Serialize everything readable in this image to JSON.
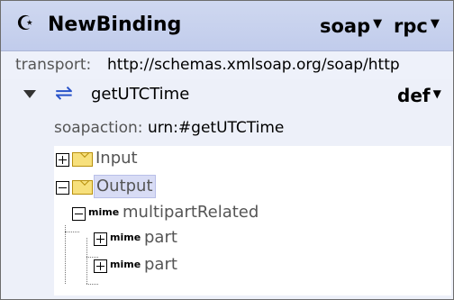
{
  "binding": {
    "icon": "binding-icon",
    "name": "NewBinding",
    "style": "soap",
    "protocol": "rpc",
    "transport_label": "transport:",
    "transport_value": "http://schemas.xmlsoap.org/soap/http"
  },
  "operation": {
    "name": "getUTCTime",
    "use": "def",
    "soapaction_label": "soapaction:",
    "soapaction_value": "urn:#getUTCTime"
  },
  "tree": {
    "input_label": "Input",
    "output_label": "Output",
    "multipart_prefix": "mime",
    "multipart_label": "multipartRelated",
    "parts": [
      {
        "prefix": "mime",
        "label": "part"
      },
      {
        "prefix": "mime",
        "label": "part"
      }
    ]
  },
  "colors": {
    "header_bg": "#b9c5e9",
    "operation_bg": "#edf0f9",
    "selection": "#d8dcf5",
    "envelope": "#f7e07c"
  }
}
